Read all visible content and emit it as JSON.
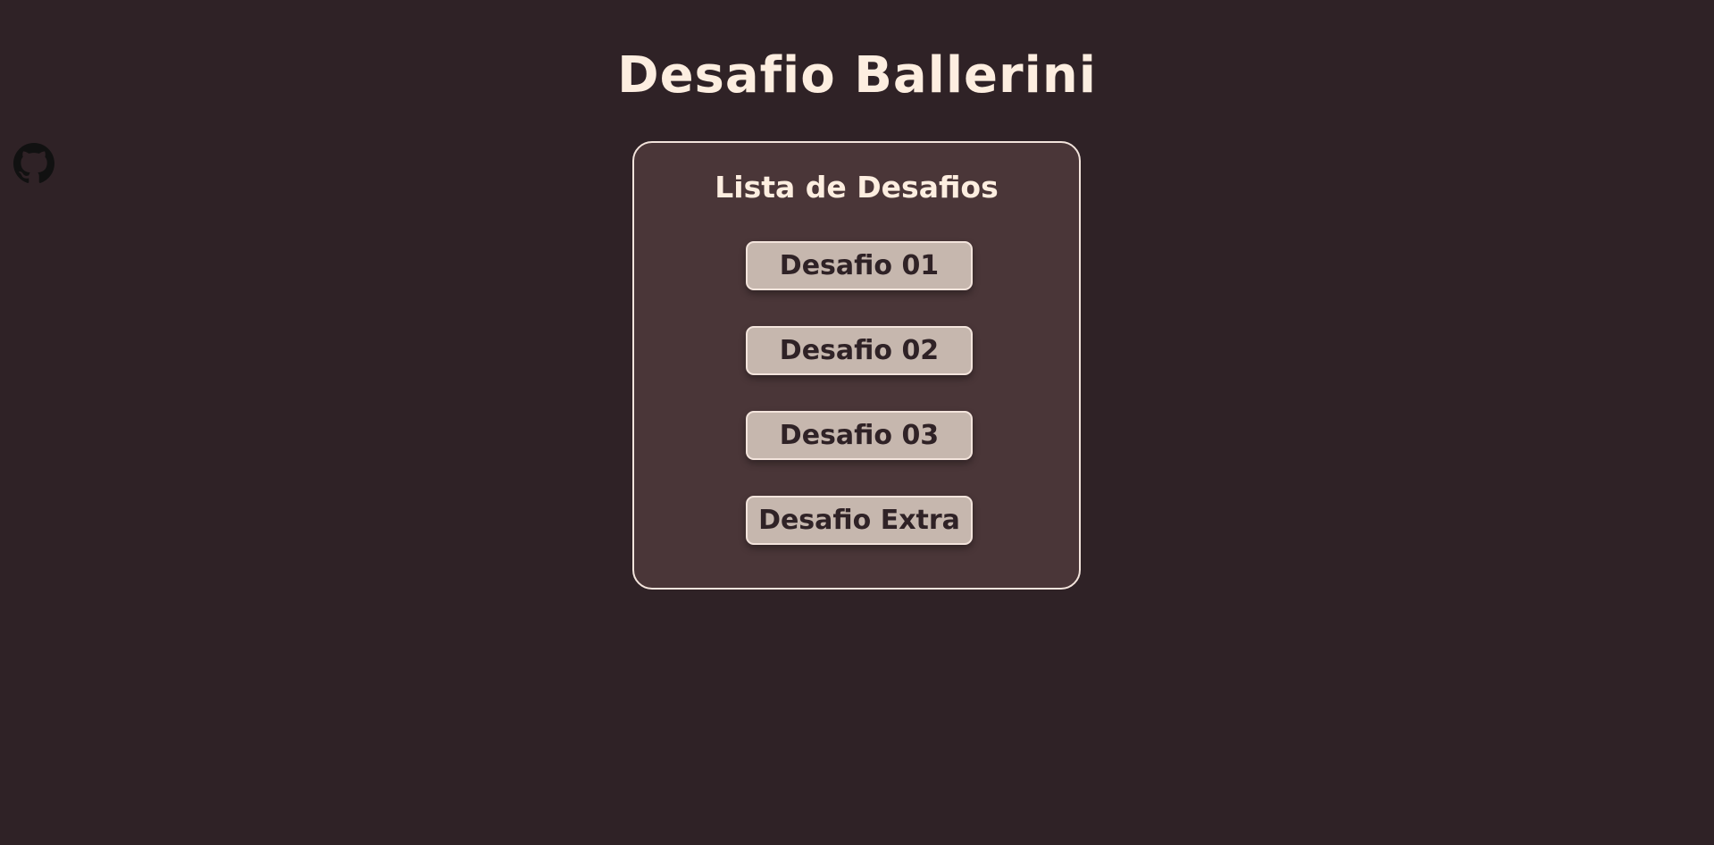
{
  "header": {
    "title": "Desafio Ballerini"
  },
  "sidebar": {
    "github_icon": "github-icon"
  },
  "card": {
    "title": "Lista de Desafios",
    "items": [
      {
        "label": "Desafio 01"
      },
      {
        "label": "Desafio 02"
      },
      {
        "label": "Desafio 03"
      },
      {
        "label": "Desafio Extra"
      }
    ]
  },
  "colors": {
    "background": "#2f2226",
    "card_background": "#4a3638",
    "card_border": "#f3e4dc",
    "button_background": "#c6b7ae",
    "button_text": "#2f2226",
    "heading_text": "#fdeee0",
    "icon": "#111111"
  }
}
